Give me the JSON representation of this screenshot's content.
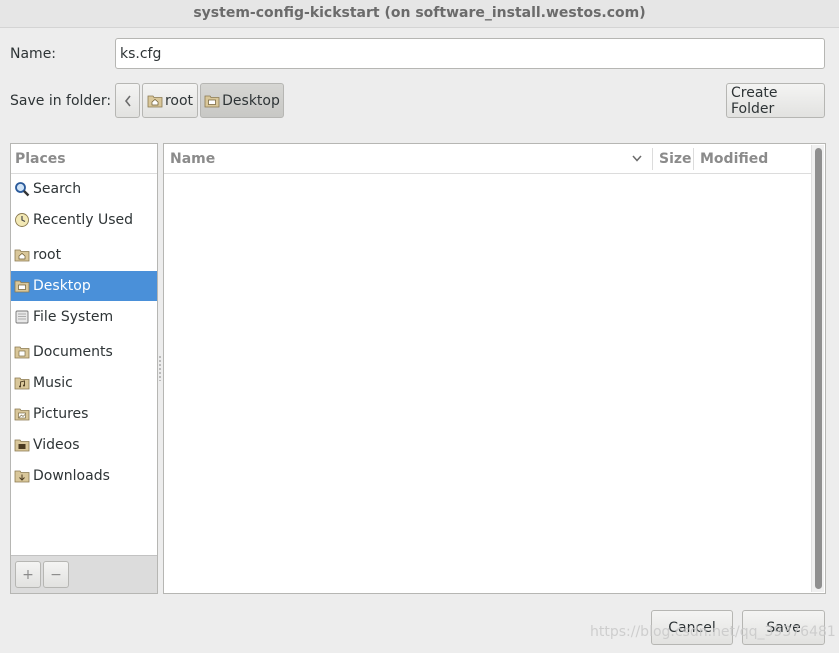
{
  "window": {
    "title": "system-config-kickstart (on software_install.westos.com)"
  },
  "form": {
    "name_label": "Name:",
    "name_value": "ks.cfg",
    "folder_label": "Save in folder:"
  },
  "breadcrumbs": [
    {
      "label": "root",
      "active": false
    },
    {
      "label": "Desktop",
      "active": true
    }
  ],
  "create_folder_label": "Create Folder",
  "places": {
    "header": "Places",
    "items": [
      {
        "label": "Search",
        "icon": "search-icon"
      },
      {
        "label": "Recently Used",
        "icon": "clock-icon"
      },
      {
        "label": "root",
        "icon": "home-folder-icon"
      },
      {
        "label": "Desktop",
        "icon": "desktop-folder-icon",
        "selected": true
      },
      {
        "label": "File System",
        "icon": "drive-icon"
      },
      {
        "label": "Documents",
        "icon": "folder-icon"
      },
      {
        "label": "Music",
        "icon": "music-folder-icon"
      },
      {
        "label": "Pictures",
        "icon": "pictures-folder-icon"
      },
      {
        "label": "Videos",
        "icon": "videos-folder-icon"
      },
      {
        "label": "Downloads",
        "icon": "downloads-folder-icon"
      }
    ],
    "add_symbol": "+",
    "remove_symbol": "−"
  },
  "files": {
    "columns": {
      "name": "Name",
      "size": "Size",
      "modified": "Modified"
    },
    "rows": []
  },
  "buttons": {
    "cancel": "Cancel",
    "save": "Save"
  },
  "watermark": "https://blog.csdn.net/qq_39376481"
}
